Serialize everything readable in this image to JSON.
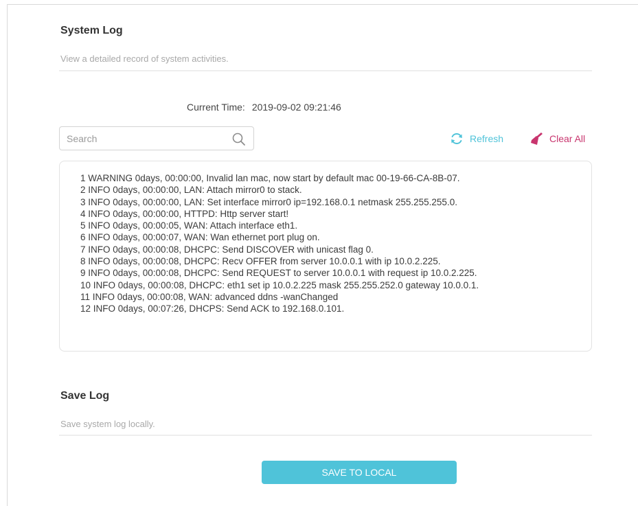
{
  "system_log": {
    "title": "System Log",
    "description": "View a detailed record of system activities."
  },
  "current_time": {
    "label": "Current Time:",
    "value": "2019-09-02 09:21:46"
  },
  "search": {
    "placeholder": "Search",
    "value": "",
    "icon": "search-icon"
  },
  "toolbar": {
    "refresh_label": "Refresh",
    "refresh_icon": "refresh-icon",
    "clear_all_label": "Clear All",
    "clear_all_icon": "broom-icon"
  },
  "log_entries": [
    "1 WARNING 0days, 00:00:00, Invalid lan mac, now start by default mac 00-19-66-CA-8B-07.",
    "2 INFO 0days, 00:00:00, LAN: Attach mirror0 to stack.",
    "3 INFO 0days, 00:00:00, LAN: Set interface mirror0 ip=192.168.0.1 netmask 255.255.255.0.",
    "4 INFO 0days, 00:00:00, HTTPD: Http server start!",
    "5 INFO 0days, 00:00:05, WAN: Attach interface eth1.",
    "6 INFO 0days, 00:00:07, WAN: Wan ethernet port plug on.",
    "7 INFO 0days, 00:00:08, DHCPC: Send DISCOVER with unicast flag 0.",
    "8 INFO 0days, 00:00:08, DHCPC: Recv OFFER from server 10.0.0.1 with ip 10.0.2.225.",
    "9 INFO 0days, 00:00:08, DHCPC: Send REQUEST to server 10.0.0.1 with request ip 10.0.2.225.",
    "10 INFO 0days, 00:00:08, DHCPC: eth1 set ip 10.0.2.225 mask 255.255.252.0 gateway 10.0.0.1.",
    "11 INFO 0days, 00:00:08, WAN: advanced ddns -wanChanged",
    "12 INFO 0days, 00:07:26, DHCPS: Send ACK to 192.168.0.101."
  ],
  "save_log": {
    "title": "Save Log",
    "description": "Save system log locally.",
    "button_label": "SAVE TO LOCAL"
  },
  "colors": {
    "accent": "#4fc3d9",
    "clear_all": "#c8356e",
    "title_text": "#333333",
    "muted_text": "#a8a8a8",
    "divider": "#eeeeee"
  }
}
